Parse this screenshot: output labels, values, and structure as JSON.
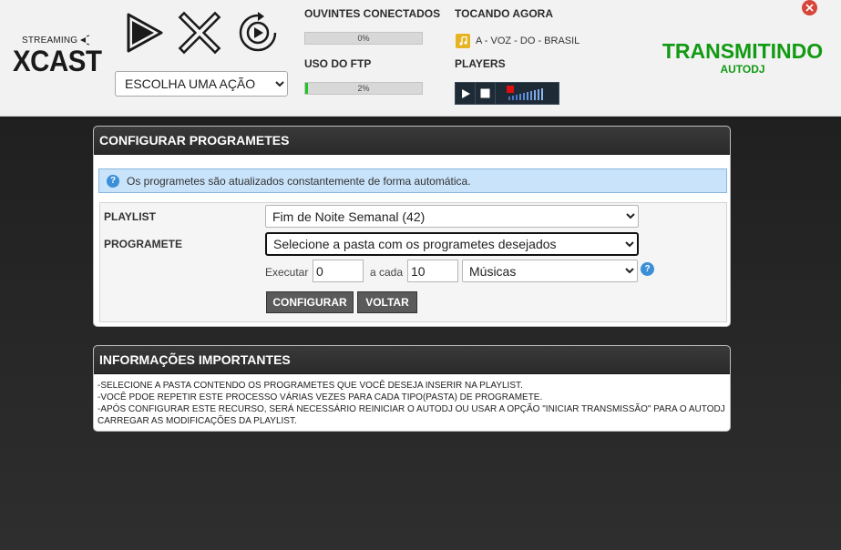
{
  "logo": {
    "small": "STREAMING",
    "name": "XCAST"
  },
  "controls": {
    "action_select": "ESCOLHA UMA AÇÃO"
  },
  "stats": {
    "listeners_label": "OUVINTES CONECTADOS",
    "listeners_value": "0%",
    "listeners_fraction": 0,
    "ftp_label": "USO DO FTP",
    "ftp_value": "2%",
    "ftp_fraction": 0.02
  },
  "now_playing": {
    "label": "TOCANDO AGORA",
    "song": "A - VOZ - DO - BRASIL"
  },
  "players": {
    "label": "PLAYERS"
  },
  "status": {
    "main": "TRANSMITINDO",
    "sub": "AUTODJ"
  },
  "config_panel": {
    "title": "CONFIGURAR PROGRAMETES",
    "info": "Os programetes são atualizados constantemente de forma automática.",
    "playlist_label": "PLAYLIST",
    "playlist_value": "Fim de Noite Semanal (42)",
    "programete_label": "PROGRAMETE",
    "programete_value": "Selecione a pasta com os programetes desejados",
    "executar_label": "Executar",
    "executar_value": "0",
    "a_cada_label": "a cada",
    "a_cada_value": "10",
    "unit_value": "Músicas",
    "configure_button": "CONFIGURAR",
    "back_button": "VOLTAR"
  },
  "info_panel": {
    "title": "INFORMAÇÕES IMPORTANTES",
    "lines": [
      "-SELECIONE A PASTA CONTENDO OS PROGRAMETES QUE VOCÊ DESEJA INSERIR NA PLAYLIST.",
      "-VOCÊ PDOE REPETIR ESTE PROCESSO VÁRIAS VEZES PARA CADA TIPO(PASTA) DE PROGRAMETE.",
      "-APÓS CONFIGURAR ESTE RECURSO, SERÁ NECESSÁRIO REINICIAR O AUTODJ OU USAR A OPÇÃO \"INICIAR TRANSMISSÃO\" PARA O AUTODJ CARREGAR AS MODIFICAÇÕES DA PLAYLIST."
    ]
  },
  "colors": {
    "status_green": "#129a12",
    "progress_green": "#22c322",
    "info_bg": "#c8e3fa",
    "panel_head": "#2e2e2e"
  },
  "icons": [
    "play-icon",
    "stop-x-icon",
    "restart-icon",
    "music-note-icon",
    "close-icon",
    "question-icon",
    "volume-icon"
  ]
}
